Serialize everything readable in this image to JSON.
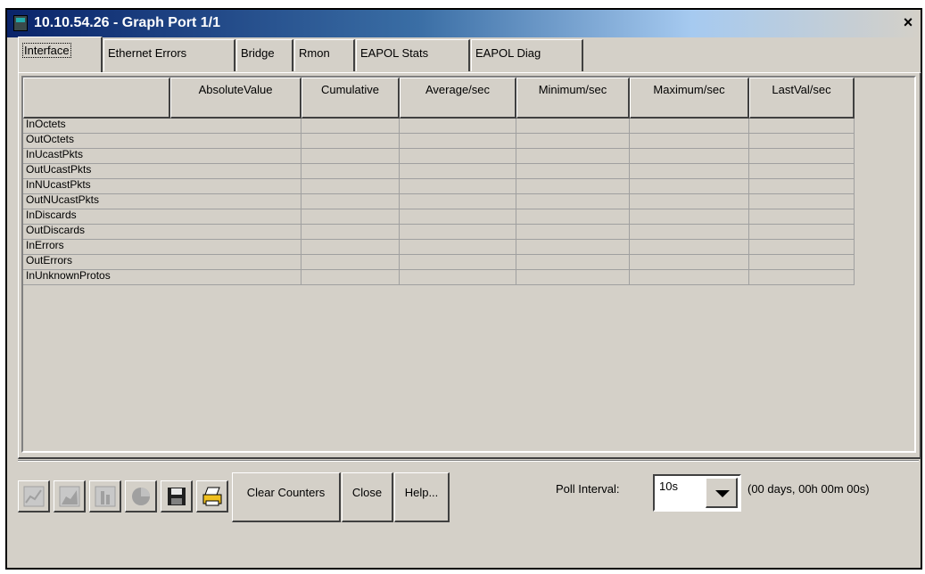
{
  "window": {
    "title": "10.10.54.26 - Graph Port 1/1",
    "close": "×"
  },
  "tabs": [
    "Interface",
    "Ethernet Errors",
    "Bridge",
    "Rmon",
    "EAPOL Stats",
    "EAPOL Diag"
  ],
  "active_tab": "Interface",
  "table": {
    "columns": [
      "AbsoluteValue",
      "Cumulative",
      "Average/sec",
      "Minimum/sec",
      "Maximum/sec",
      "LastVal/sec"
    ],
    "rows": [
      "InOctets",
      "OutOctets",
      "InUcastPkts",
      "OutUcastPkts",
      "InNUcastPkts",
      "OutNUcastPkts",
      "InDiscards",
      "OutDiscards",
      "InErrors",
      "OutErrors",
      "InUnknownProtos"
    ]
  },
  "toolbar": {
    "icons": [
      "line-chart-icon",
      "area-chart-icon",
      "bar-chart-icon",
      "pie-chart-icon",
      "save-icon",
      "print-icon"
    ],
    "clear_counters": "Clear Counters",
    "close": "Close",
    "help": "Help...",
    "poll_label": "Poll Interval:",
    "poll_value": "10s",
    "poll_elapsed": "(00 days, 00h 00m 00s)"
  }
}
